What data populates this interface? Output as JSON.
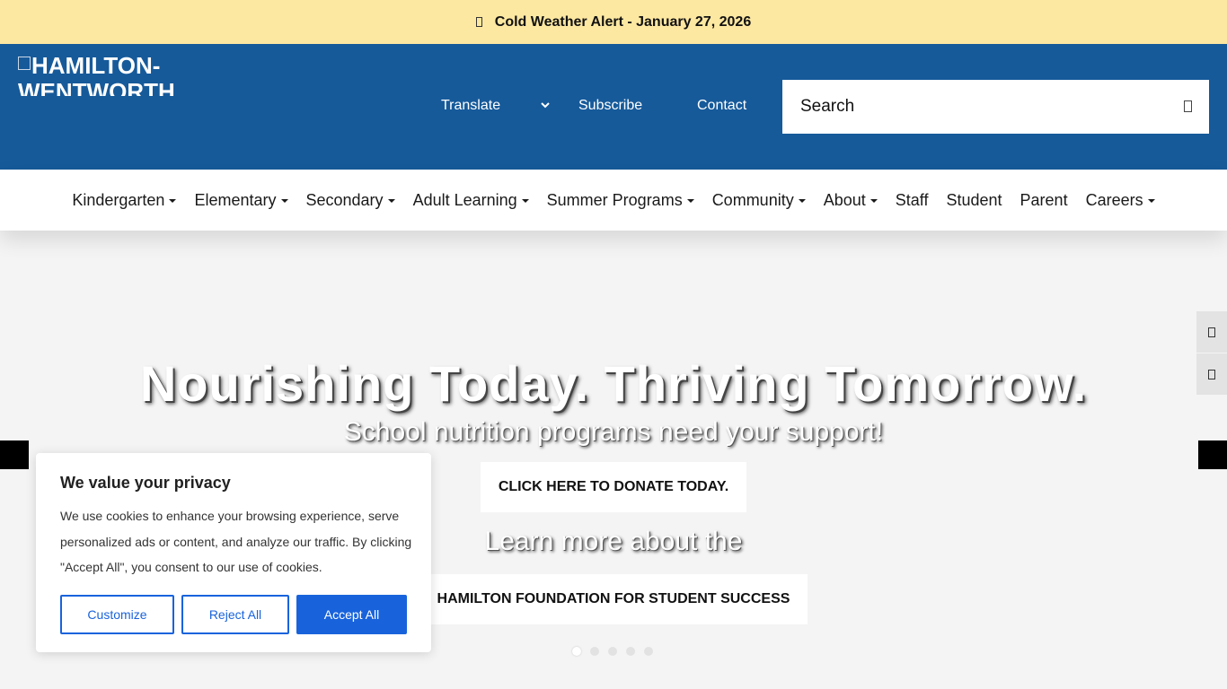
{
  "alert": {
    "text": "Cold Weather Alert - January 27, 2026",
    "icon": "alert-box-icon"
  },
  "header": {
    "logo_alt": "HAMILTON-WENTWORTH",
    "links": {
      "translate": "Translate",
      "subscribe": "Subscribe",
      "contact": "Contact"
    },
    "search": {
      "placeholder": "Search",
      "icon": "search-icon"
    },
    "colors": {
      "header_bg": "#165a9a",
      "alert_bg": "#fde8a1"
    }
  },
  "nav": {
    "items": [
      {
        "label": "Kindergarten",
        "dropdown": true
      },
      {
        "label": "Elementary",
        "dropdown": true
      },
      {
        "label": "Secondary",
        "dropdown": true
      },
      {
        "label": "Adult Learning",
        "dropdown": true
      },
      {
        "label": "Summer Programs",
        "dropdown": true
      },
      {
        "label": "Community",
        "dropdown": true
      },
      {
        "label": "About",
        "dropdown": true
      },
      {
        "label": "Staff",
        "dropdown": false
      },
      {
        "label": "Student",
        "dropdown": false
      },
      {
        "label": "Parent",
        "dropdown": false
      },
      {
        "label": "Careers",
        "dropdown": true
      }
    ]
  },
  "hero": {
    "title": "Nourishing Today. Thriving Tomorrow.",
    "subtitle": "School nutrition programs need your support!",
    "donate_label": "CLICK HERE TO DONATE TODAY.",
    "learn_more": "Learn more about the",
    "foundation_label": "HAMILTON FOUNDATION FOR STUDENT SUCCESS",
    "slides_total": 5,
    "active_slide": 1
  },
  "cookie": {
    "title": "We value your privacy",
    "body": "We use cookies to enhance your browsing experience, serve personalized ads or content, and analyze our traffic. By clicking \"Accept All\", you consent to our use of cookies.",
    "customize": "Customize",
    "reject": "Reject All",
    "accept": "Accept All",
    "accent": "#1863dc"
  }
}
